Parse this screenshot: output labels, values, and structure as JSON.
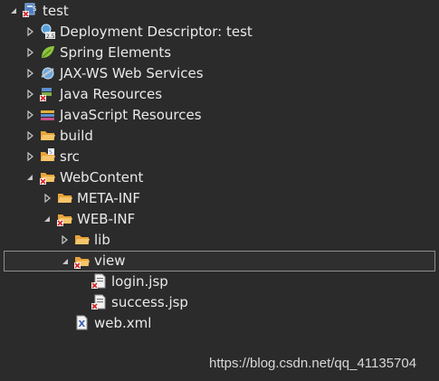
{
  "tree": {
    "items": [
      {
        "label": "test",
        "icon": "web-project-icon"
      },
      {
        "label": "Deployment Descriptor: test",
        "icon": "deployment-descriptor-icon"
      },
      {
        "label": "Spring Elements",
        "icon": "spring-leaf-icon"
      },
      {
        "label": "JAX-WS Web Services",
        "icon": "web-services-icon"
      },
      {
        "label": "Java Resources",
        "icon": "java-resources-icon"
      },
      {
        "label": "JavaScript Resources",
        "icon": "javascript-resources-icon"
      },
      {
        "label": "build",
        "icon": "folder-icon"
      },
      {
        "label": "src",
        "icon": "source-folder-icon"
      },
      {
        "label": "WebContent",
        "icon": "folder-error-icon"
      },
      {
        "label": "META-INF",
        "icon": "folder-icon"
      },
      {
        "label": "WEB-INF",
        "icon": "folder-error-icon"
      },
      {
        "label": "lib",
        "icon": "folder-icon"
      },
      {
        "label": "view",
        "icon": "folder-error-icon"
      },
      {
        "label": "login.jsp",
        "icon": "jsp-file-error-icon"
      },
      {
        "label": "success.jsp",
        "icon": "jsp-file-error-icon"
      },
      {
        "label": "web.xml",
        "icon": "xml-file-icon"
      }
    ]
  },
  "watermark": "https://blog.csdn.net/qq_41135704",
  "colors": {
    "background": "#2b2b2b",
    "text": "#e9e9e9",
    "selection_border": "#8e8e8e",
    "folder": "#e8a33c",
    "error_mark": "#d22c2c"
  }
}
